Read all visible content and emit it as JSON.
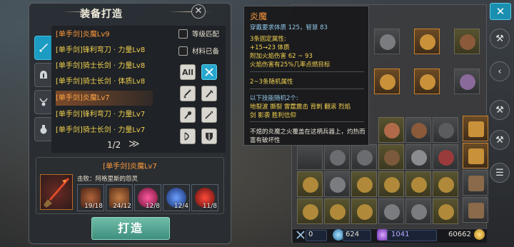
{
  "craft": {
    "title": "装备打造",
    "recipes": [
      "[单手剑]炎魔Lv9",
      "[单手剑]锋利弯刀 · 力量Lv8",
      "[单手剑]骑士长剑 · 力量Lv8",
      "[单手剑]骑士长剑 · 体质Lv8",
      "[单手剑]炎魔Lv7",
      "[单手剑]锋利弯刀 · 力量Lv7",
      "[单手剑]骑士长剑 · 力量Lv7"
    ],
    "filters": {
      "level_match": "等级匹配",
      "materials_ready": "材料已备",
      "all": "All"
    },
    "pager": "1/2",
    "pager_next": "≫",
    "selected_name": "[单手剑]炎魔Lv7",
    "kill_label": "击败：阿格里斯的怨灵",
    "materials": [
      {
        "count": "19/18",
        "color": "#7a3b28"
      },
      {
        "count": "24/12",
        "color": "#8a4a2c"
      },
      {
        "count": "12/8",
        "color": "#c0306a"
      },
      {
        "count": "12/4",
        "color": "#2f5fb8"
      },
      {
        "count": "11/8",
        "color": "#b52222"
      }
    ],
    "craft_button": "打造"
  },
  "tooltip": {
    "name": "炎魔",
    "requirement": "穿戴要求体质 125，智慧 83",
    "fixed_header": "3条固定属性:",
    "fixed_lines": [
      "+15→23 体质",
      "附加火焰伤害 62 ~ 93",
      "火焰伤害有25%几率点燃目标"
    ],
    "random_count": "2~3条随机属性",
    "random_header": "以下技能随机2个:",
    "skills_1": "地裂波 撕裂 雷霆震击 背刺 翻滚 烈焰",
    "skills_2": "剑 影袭 胜利信仰",
    "flavor_1": "不熄的炎魔之火覆盖在这柄兵器上，灼热而",
    "flavor_2": "富有破坏性"
  },
  "currency": {
    "attack": "0",
    "crystal": "624",
    "gem": "1041",
    "gold": "60662"
  },
  "colors": {
    "accent": "#1c9cc2",
    "recipe_yellow": "#f2d250",
    "recipe_orange": "#ff9a3c",
    "craft_button": "#4fa593"
  }
}
